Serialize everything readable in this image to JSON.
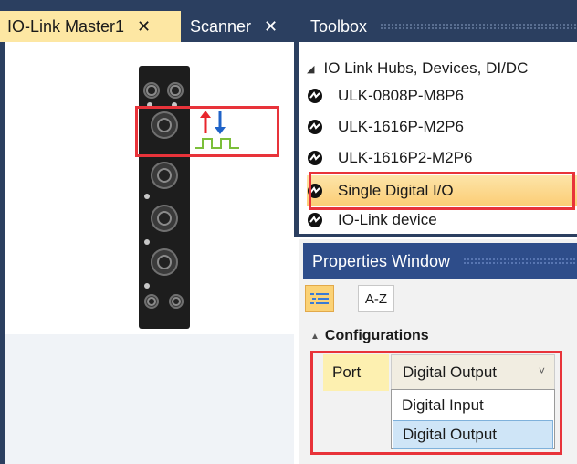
{
  "tabs": [
    {
      "label": "IO-Link Master1",
      "close": "✕"
    },
    {
      "label": "Scanner",
      "close": "✕"
    }
  ],
  "toolbox": {
    "title": "Toolbox",
    "group": "IO Link Hubs, Devices, DI/DC",
    "items": [
      {
        "label": "ULK-0808P-M8P6"
      },
      {
        "label": "ULK-1616P-M2P6"
      },
      {
        "label": "ULK-1616P2-M2P6"
      },
      {
        "label": "Single Digital I/O",
        "selected": true
      },
      {
        "label": "IO-Link device"
      }
    ]
  },
  "properties": {
    "title": "Properties Window",
    "az_label": "A-Z",
    "section": "Configurations",
    "row": {
      "name": "Port",
      "value": "Digital Output",
      "chevron": "˅"
    },
    "dropdown_options": [
      "Digital Input",
      "Digital Output"
    ],
    "selected_option": "Digital Output"
  },
  "colors": {
    "highlight_border": "#e8333a",
    "frame_dark": "#2b3f60",
    "properties_header": "#2e4d8a",
    "active_tab": "#fde7a3"
  }
}
